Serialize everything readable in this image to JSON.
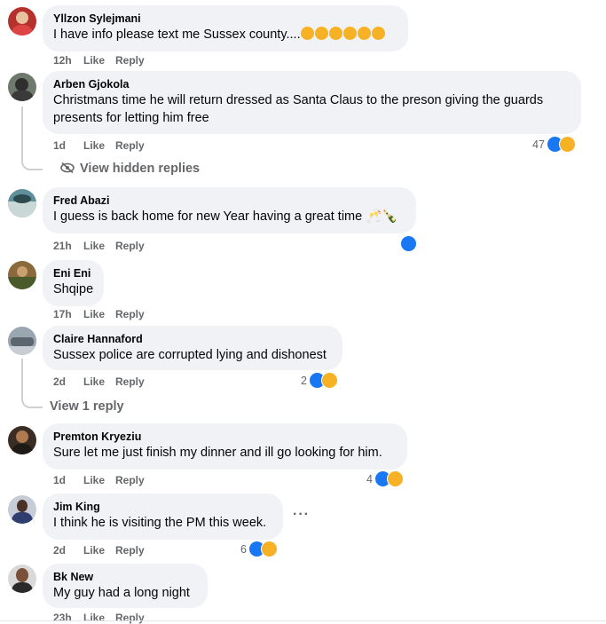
{
  "comments": [
    {
      "name": "Yllzon Sylejmani",
      "text": "I have info please text me Sussex county....",
      "emoji_count": 6,
      "time": "12h",
      "like": "Like",
      "reply": "Reply"
    },
    {
      "name": "Arben Gjokola",
      "text": "Christmans time he will return dressed as Santa Claus to the preson giving the guards presents for letting him free",
      "time": "1d",
      "like": "Like",
      "reply": "Reply",
      "reactions": "47",
      "thread": {
        "label": "View hidden replies",
        "icon": "eye-off-icon"
      }
    },
    {
      "name": "Fred Abazi",
      "text": "I guess is back home for new Year having a great time 🥂🍾",
      "time": "21h",
      "like": "Like",
      "reply": "Reply"
    },
    {
      "name": "Eni Eni",
      "text": "Shqipe",
      "time": "17h",
      "like": "Like",
      "reply": "Reply"
    },
    {
      "name": "Claire Hannaford",
      "text": "Sussex police are corrupted lying and dishonest",
      "time": "2d",
      "like": "Like",
      "reply": "Reply",
      "reactions": "2",
      "thread": {
        "label": "View 1 reply"
      }
    },
    {
      "name": "Premton Kryeziu",
      "text": "Sure let me just finish my dinner and ill go looking for him.",
      "time": "1d",
      "like": "Like",
      "reply": "Reply",
      "reactions": "4"
    },
    {
      "name": "Jim King",
      "text": "I think he is visiting the PM this week.",
      "time": "2d",
      "like": "Like",
      "reply": "Reply",
      "reactions": "6",
      "more": "···"
    },
    {
      "name": "Bk New",
      "text": "My guy had a long night",
      "time": "23h",
      "like": "Like",
      "reply": "Reply"
    }
  ],
  "colors": {
    "bubble": "#f0f2f5",
    "meta": "#65676b",
    "like_blue": "#1877f2",
    "haha_yellow": "#f7b125"
  }
}
